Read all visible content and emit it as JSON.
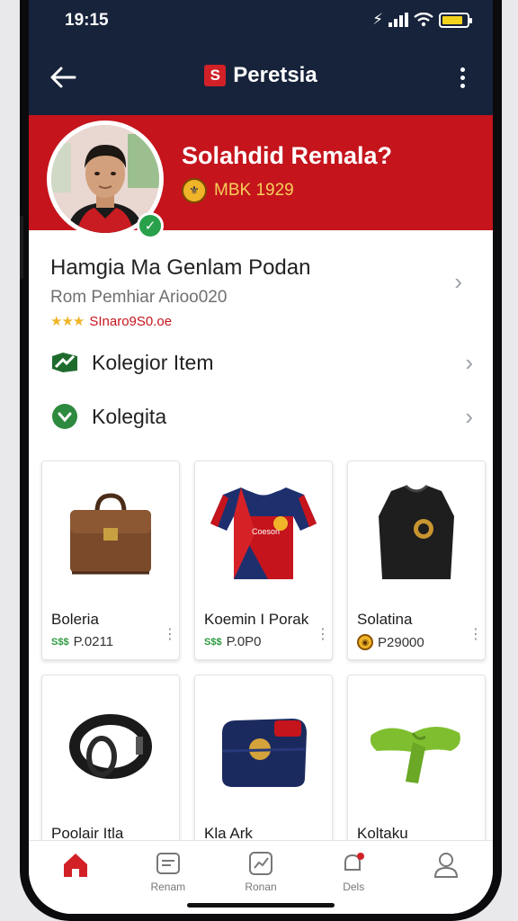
{
  "status_bar": {
    "time": "19:15",
    "signal_glyph": "⚡",
    "wifi_glyph": "⁘",
    "battery_level": 0.85,
    "battery_color": "#f3d21b"
  },
  "app_bar": {
    "title": "Peretsia",
    "logo_glyph": "S",
    "back_icon": "arrow-left-icon",
    "more_icon": "more-vertical-icon"
  },
  "profile": {
    "name": "Solahdid Remala?",
    "meta": "MBK 1929",
    "meta_icon_glyph": "⚜",
    "verified_glyph": "✓",
    "band_color": "#c5141c"
  },
  "info": {
    "title": "Hamgia Ma Genlam Podan",
    "subtitle": "Rom Pemhiar Arioo020",
    "stars": "★★★",
    "rating_text": "SInaro9S0.oe"
  },
  "menu": [
    {
      "label": "Kolegior Item",
      "icon": "collection-icon"
    },
    {
      "label": "Kolegita",
      "icon": "shield-icon"
    }
  ],
  "products": [
    {
      "name": "Boleria",
      "price_badge": "S$$",
      "price": "P.0211",
      "price_icon": "badge"
    },
    {
      "name": "Koemin I Porak",
      "price_badge": "S$$",
      "price": "P.0P0",
      "price_icon": "badge"
    },
    {
      "name": "Solatina",
      "price_badge": "",
      "price": "P29000",
      "price_icon": "coin"
    },
    {
      "name": "Poolair Itla",
      "price_badge": "",
      "price": "",
      "price_icon": "none"
    },
    {
      "name": "Kla Ark",
      "price_badge": "",
      "price": "",
      "price_icon": "none"
    },
    {
      "name": "Koltaku",
      "price_badge": "",
      "price": "",
      "price_icon": "none"
    }
  ],
  "bottom_nav": [
    {
      "label": "",
      "icon": "home-icon",
      "active": true
    },
    {
      "label": "Renam",
      "icon": "inbox-icon",
      "active": false
    },
    {
      "label": "Ronan",
      "icon": "chart-icon",
      "active": false
    },
    {
      "label": "Dels",
      "icon": "notification-icon",
      "active": false
    },
    {
      "label": "",
      "icon": "profile-icon",
      "active": false
    }
  ]
}
